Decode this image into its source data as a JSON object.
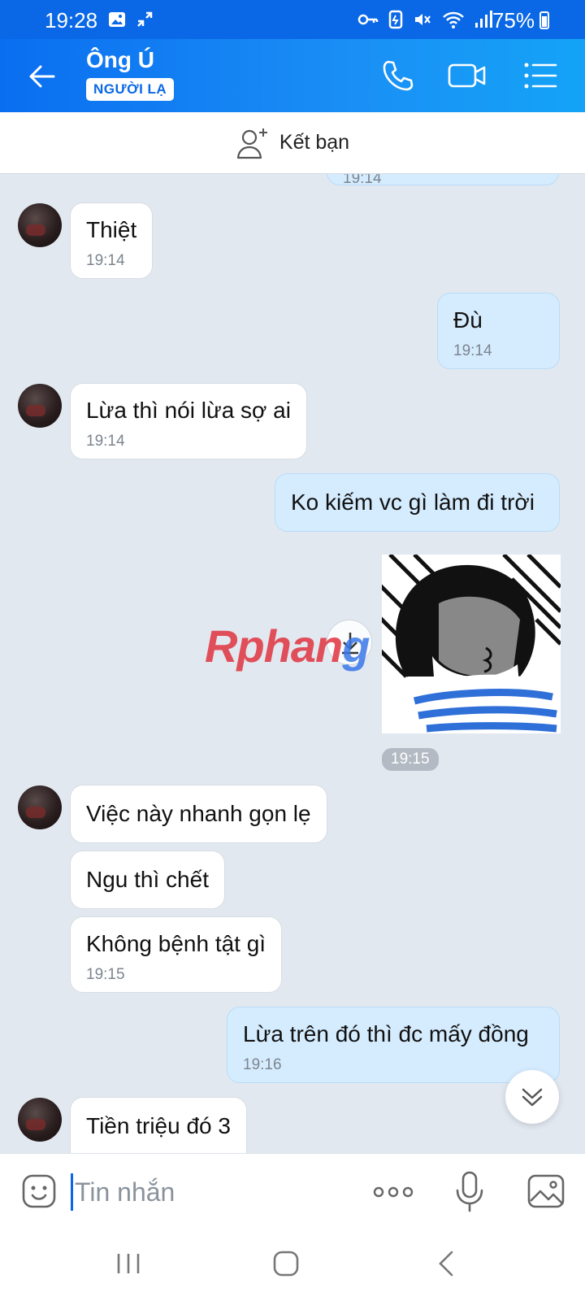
{
  "status_bar": {
    "time": "19:28",
    "battery": "75%",
    "icons": [
      "gallery-icon",
      "call-forward-icon",
      "key-icon",
      "nfc-icon",
      "mute-icon",
      "wifi-icon",
      "signal-icon",
      "battery-icon"
    ]
  },
  "header": {
    "contact_name": "Ông Ú",
    "badge": "NGƯỜI LẠ",
    "icons": [
      "back-arrow-icon",
      "phone-icon",
      "video-call-icon",
      "menu-list-icon"
    ]
  },
  "add_friend": {
    "label": "Kết bạn"
  },
  "messages": [
    {
      "dir": "out",
      "text": "",
      "time": "19:14",
      "partial": true
    },
    {
      "dir": "in",
      "text": "Thiệt",
      "time": "19:14"
    },
    {
      "dir": "out",
      "text": "Đù",
      "time": "19:14"
    },
    {
      "dir": "in",
      "text": "Lừa thì nói lừa sợ ai",
      "time": "19:14"
    },
    {
      "dir": "out",
      "text": "Ko kiếm vc gì làm đi trời",
      "time": ""
    },
    {
      "dir": "out",
      "type": "sticker",
      "time": "19:15"
    },
    {
      "dir": "in",
      "text": "Việc này nhanh gọn lẹ",
      "time": ""
    },
    {
      "dir": "in",
      "text": "Ngu thì chết",
      "time": ""
    },
    {
      "dir": "in",
      "text": "Không bệnh tật gì",
      "time": "19:15"
    },
    {
      "dir": "out",
      "text": "Lừa trên đó thì đc mấy đồng",
      "time": "19:16"
    },
    {
      "dir": "in",
      "text": "Tiền triệu đó 3",
      "time": ""
    }
  ],
  "watermark": {
    "part1": "Rphan",
    "part2": "g"
  },
  "composer": {
    "placeholder": "Tin nhắn"
  },
  "colors": {
    "accent": "#0a68e6",
    "out_bubble": "#d5ecfe",
    "in_bubble": "#ffffff",
    "chat_bg": "#e2e8f0"
  }
}
